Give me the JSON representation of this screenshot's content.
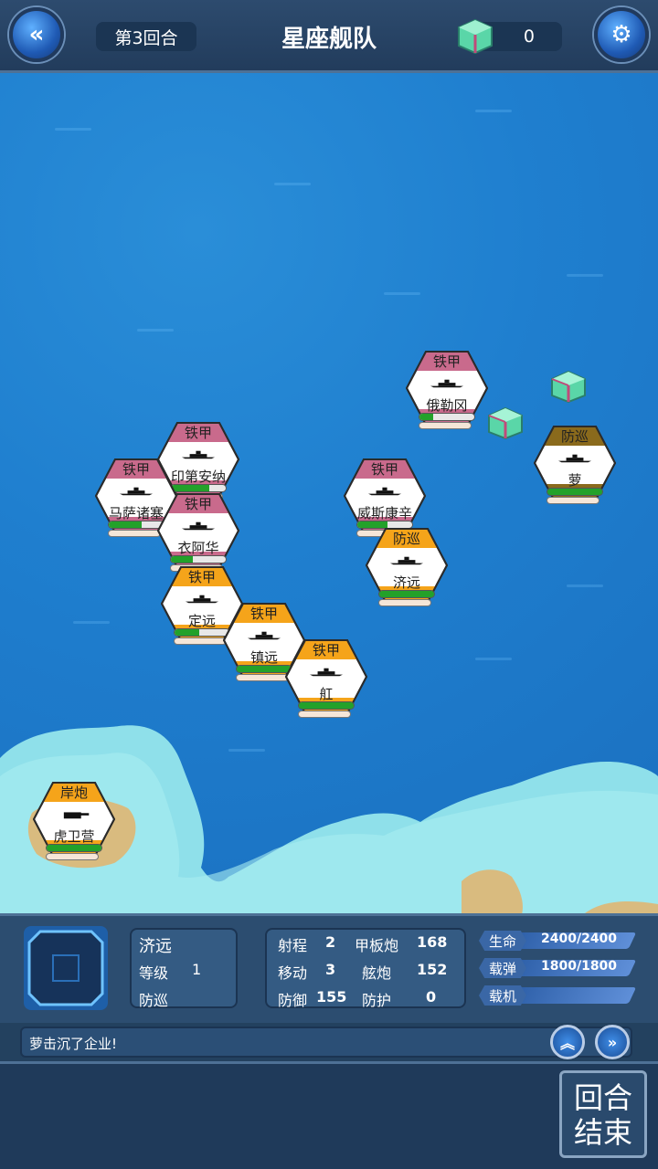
{
  "header": {
    "back_icon": "double-chevron-left-icon",
    "round": "第3回合",
    "title": "星座舰队",
    "chest_icon": "treasure-chest-icon",
    "chest_count": "0",
    "settings_icon": "gear-wrench-icon"
  },
  "units": [
    {
      "id": "ogle",
      "cls": "铁甲",
      "name": "俄勒冈",
      "color": "#c96a8c",
      "hp": 0.25
    },
    {
      "id": "indiana",
      "cls": "铁甲",
      "name": "印第安纳",
      "color": "#c96a8c",
      "hp": 0.7
    },
    {
      "id": "mass",
      "cls": "铁甲",
      "name": "马萨诸塞",
      "color": "#c96a8c",
      "hp": 0.6
    },
    {
      "id": "iowa",
      "cls": "铁甲",
      "name": "衣阿华",
      "color": "#c96a8c",
      "hp": 0.4
    },
    {
      "id": "wisconsin",
      "cls": "铁甲",
      "name": "威斯康辛",
      "color": "#c96a8c",
      "hp": 0.55
    },
    {
      "id": "jiyuan",
      "cls": "防巡",
      "name": "济远",
      "color": "#f5a41a",
      "hp": 1.0
    },
    {
      "id": "dingyuan",
      "cls": "铁甲",
      "name": "定远",
      "color": "#f5a41a",
      "hp": 0.45
    },
    {
      "id": "zhenyuan",
      "cls": "铁甲",
      "name": "镇远",
      "color": "#f5a41a",
      "hp": 1.0
    },
    {
      "id": "hong",
      "cls": "铁甲",
      "name": "舡",
      "color": "#f5a41a",
      "hp": 1.0
    },
    {
      "id": "meng",
      "cls": "防巡",
      "name": "萝",
      "color": "#8a6a1c",
      "hp": 1.0
    },
    {
      "id": "huwei",
      "cls": "岸炮",
      "name": "虎卫营",
      "color": "#f5a41a",
      "hp": 1.0
    }
  ],
  "selected": {
    "name": "济远",
    "level_label": "等级",
    "level": "1",
    "type": "防巡",
    "stats": {
      "range_label": "射程",
      "range": "2",
      "move_label": "移动",
      "move": "3",
      "defense_label": "防御",
      "defense": "155",
      "deck_gun_label": "甲板炮",
      "deck_gun": "168",
      "bow_gun_label": "舷炮",
      "bow_gun": "152",
      "armor_label": "防护",
      "armor": "0"
    },
    "hp_label": "生命",
    "hp": "2400/2400",
    "ammo_label": "载弹",
    "ammo": "1800/1800",
    "aircraft_label": "载机",
    "aircraft": ""
  },
  "log": {
    "message": "萝击沉了企业!"
  },
  "end_turn": {
    "line1": "回合",
    "line2": "结束"
  },
  "colors": {
    "battleship": "#c96a8c",
    "cruiser": "#f5a41a",
    "enemy_cruiser": "#8a6a1c",
    "hp_green": "#23a12a",
    "sea": "#1f7fcf"
  }
}
